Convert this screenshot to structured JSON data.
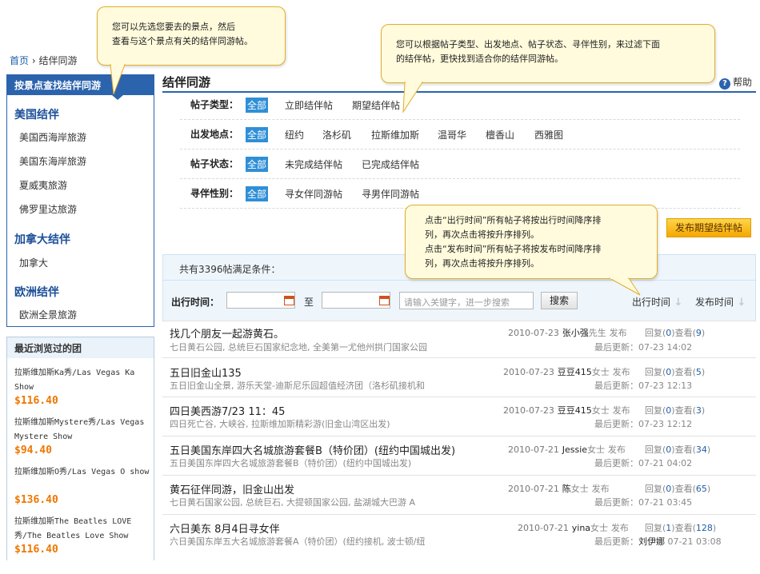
{
  "breadcrumb": {
    "home": "首页",
    "sep": "›",
    "current": "结伴同游"
  },
  "sidebar": {
    "title": "按景点查找结伴同游",
    "groups": [
      {
        "name": "美国结伴",
        "items": [
          "美国西海岸旅游",
          "美国东海岸旅游",
          "夏威夷旅游",
          "佛罗里达旅游"
        ]
      },
      {
        "name": "加拿大结伴",
        "items": [
          "加拿大"
        ]
      },
      {
        "name": "欧洲结伴",
        "items": [
          "欧洲全景旅游"
        ]
      }
    ]
  },
  "recent": {
    "title": "最近浏览过的团",
    "items": [
      {
        "name": "拉斯维加斯Ka秀/Las Vegas Ka Show",
        "price": "$116.40"
      },
      {
        "name": "拉斯维加斯Mystere秀/Las Vegas Mystere Show",
        "price": "$94.40"
      },
      {
        "name": "拉斯维加斯O秀/Las Vegas O show",
        "price": "$136.40"
      },
      {
        "name": "拉斯维加斯The Beatles LOVE秀/The Beatles Love Show",
        "price": "$116.40"
      }
    ]
  },
  "main": {
    "title": "结伴同游",
    "help": "帮助"
  },
  "filters": [
    {
      "label": "帖子类型：",
      "options": [
        "全部",
        "立即结伴帖",
        "期望结伴帖"
      ]
    },
    {
      "label": "出发地点：",
      "options": [
        "全部",
        "纽约",
        "洛杉矶",
        "拉斯维加斯",
        "温哥华",
        "檀香山",
        "西雅图"
      ]
    },
    {
      "label": "帖子状态：",
      "options": [
        "全部",
        "未完成结伴帖",
        "已完成结伴帖"
      ]
    },
    {
      "label": "寻伴性别：",
      "options": [
        "全部",
        "寻女伴同游帖",
        "寻男伴同游帖"
      ]
    }
  ],
  "post_button": "发布期望结伴帖",
  "results": {
    "count_text": "共有3396帖满足条件：",
    "date_label": "出行时间：",
    "to_label": "至",
    "keyword_placeholder": "请输入关键字，进一步搜索",
    "search_label": "搜索",
    "sort_travel": "出行时间",
    "sort_post": "发布时间"
  },
  "posts": [
    {
      "title": "找几个朋友一起游黄石。",
      "sub": "七日黄石公园, 总统巨石国家纪念地, 全美第一尤他州拱门国家公园",
      "date": "2010-07-23",
      "user": "张小强",
      "title_suffix": "先生",
      "action": "发布",
      "replies": "0",
      "views": "9",
      "updated": "07-23 14:02",
      "updater": ""
    },
    {
      "title": "五日旧金山135",
      "sub": "五日旧金山全景, 游乐天堂-迪斯尼乐园超值经济团（洛杉矶接机和",
      "date": "2010-07-23",
      "user": "豆豆415",
      "title_suffix": "女士",
      "action": "发布",
      "replies": "0",
      "views": "5",
      "updated": "07-23 12:13",
      "updater": ""
    },
    {
      "title": "四日美西游7/23 11：45",
      "sub": "四日死亡谷, 大峡谷, 拉斯维加斯精彩游(旧金山湾区出发)",
      "date": "2010-07-23",
      "user": "豆豆415",
      "title_suffix": "女士",
      "action": "发布",
      "replies": "0",
      "views": "3",
      "updated": "07-23 12:12",
      "updater": ""
    },
    {
      "title": "五日美国东岸四大名城旅游套餐B（特价团）(纽约中国城出发)",
      "sub": "五日美国东岸四大名城旅游套餐B（特价团）(纽约中国城出发)",
      "date": "2010-07-21",
      "user": "Jessie",
      "title_suffix": "女士",
      "action": "发布",
      "replies": "0",
      "views": "34",
      "updated": "07-21 04:02",
      "updater": ""
    },
    {
      "title": "黄石征伴同游，旧金山出发",
      "sub": "七日黄石国家公园, 总统巨石, 大提顿国家公园, 盐湖城大巴游 A",
      "date": "2010-07-21",
      "user": "陈",
      "title_suffix": "女士",
      "action": "发布",
      "replies": "0",
      "views": "65",
      "updated": "07-21 03:45",
      "updater": ""
    },
    {
      "title": "六日美东 8月4日寻女伴",
      "sub": "六日美国东岸五大名城旅游套餐A（特价团）(纽约接机, 波士顿/纽",
      "date": "2010-07-21",
      "user": "yina",
      "title_suffix": "女士",
      "action": "发布",
      "replies": "1",
      "views": "128",
      "updated": "07-21 03:08",
      "updater": "刘伊娜"
    }
  ],
  "stats": {
    "reply": "回复",
    "view": "查看",
    "last_update": "最后更新："
  },
  "callouts": {
    "sidebar_tip": "您可以先选您要去的景点，然后\n查看与这个景点有关的结伴同游帖。",
    "filter_tip": "您可以根据帖子类型、出发地点、帖子状态、寻伴性别，来过滤下面\n的结伴帖，更快找到适合你的结伴同游帖。",
    "sort_tip": "点击“出行时间”所有帖子将按出行时间降序排\n列，再次点击将按升序排列。\n点击“发布时间”所有帖子将按发布时间降序排\n列，再次点击将按升序排列。"
  },
  "colors": {
    "brand_blue": "#2c63ad",
    "price_orange": "#ee7700",
    "callout_bg": "#fffbdc",
    "selected_filter": "#2f8fd6",
    "post_button": "#f5a800"
  }
}
